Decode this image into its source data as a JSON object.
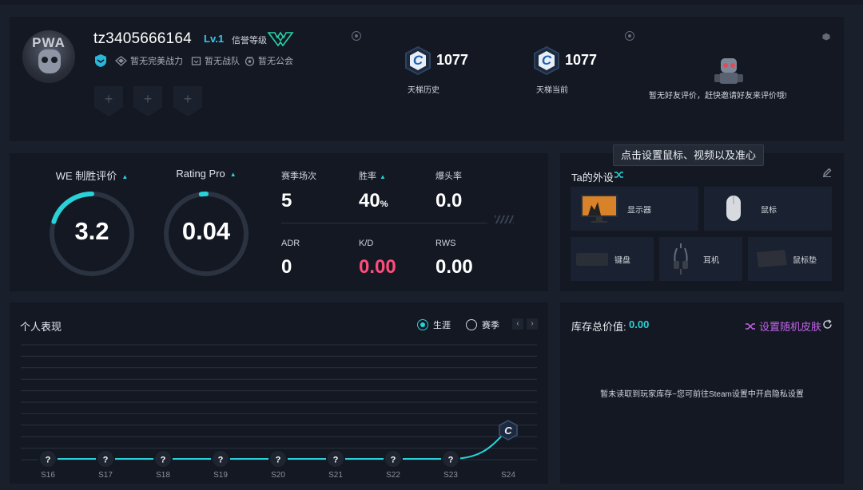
{
  "profile": {
    "username": "tz3405666164",
    "level": "Lv.1",
    "credit_label": "信誉等级",
    "tags": [
      "暂无完美战力",
      "暂无战队",
      "暂无公会"
    ],
    "slot_symbol": "+",
    "ladder": [
      {
        "badge": "C",
        "score": "1077",
        "label": "天梯历史"
      },
      {
        "badge": "C",
        "score": "1077",
        "label": "天梯当前"
      }
    ],
    "friend_eval": "暂无好友评价，赶快邀请好友来评价哦!",
    "avatar_text": "PWA"
  },
  "ratings": {
    "we_label": "WE 制胜评价",
    "we_value": "3.2",
    "we_fraction": 0.2,
    "pro_label": "Rating Pro",
    "pro_value": "0.04",
    "pro_fraction": 0.02,
    "stats": {
      "matches_label": "赛季场次",
      "matches_value": "5",
      "winrate_label": "胜率",
      "winrate_value": "40",
      "winrate_unit": "%",
      "hs_label": "爆头率",
      "hs_value": "0.0",
      "adr_label": "ADR",
      "adr_value": "0",
      "kd_label": "K/D",
      "kd_value": "0.00",
      "rws_label": "RWS",
      "rws_value": "0.00"
    }
  },
  "gear": {
    "title": "Ta的外设",
    "tooltip": "点击设置鼠标、视频以及准心",
    "items": [
      "显示器",
      "鼠标",
      "键盘",
      "耳机",
      "鼠标垫"
    ]
  },
  "performance": {
    "title": "个人表现",
    "radio_career": "生涯",
    "radio_season": "赛季",
    "prev": "‹",
    "next": "›"
  },
  "chart_data": {
    "type": "line",
    "title": "个人表现",
    "categories": [
      "S16",
      "S17",
      "S18",
      "S19",
      "S20",
      "S21",
      "S22",
      "S23",
      "S24"
    ],
    "series": [
      {
        "values": [
          0,
          0,
          0,
          0,
          0,
          0,
          0,
          0,
          1
        ],
        "markers": [
          "?",
          "?",
          "?",
          "?",
          "?",
          "?",
          "?",
          "?",
          "C"
        ]
      }
    ],
    "grid": true,
    "colors": {
      "line": "#28d2d8"
    }
  },
  "inventory": {
    "title": "库存总价值:",
    "value": "0.00",
    "random_skin": "设置随机皮肤",
    "empty_msg": "暂未读取到玩家库存~您可前往Steam设置中开启隐私设置"
  },
  "colors": {
    "accent": "#28d2d8",
    "level": "#39c8ef",
    "kd_red": "#ff4d7a",
    "skin_purple": "#c264e8"
  }
}
